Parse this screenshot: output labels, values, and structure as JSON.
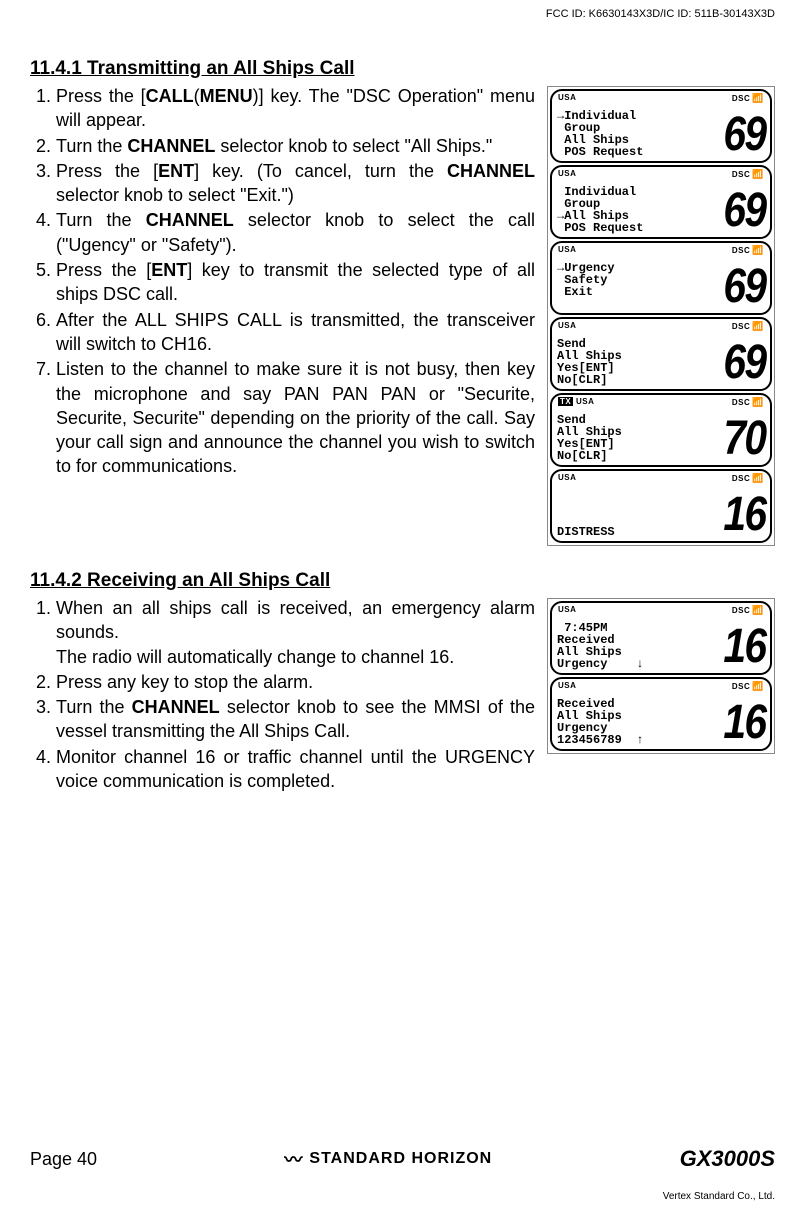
{
  "fcc": "FCC ID: K6630143X3D/IC ID: 511B-30143X3D",
  "section1": {
    "heading": "11.4.1  Transmitting an All Ships Call",
    "steps": {
      "s1a": "Press the [",
      "s1b": "CALL",
      "s1c": "(",
      "s1d": "MENU",
      "s1e": ")] key. The \"",
      "s1f": "DSC Operation",
      "s1g": "\" menu will appear.",
      "s2a": "Turn the ",
      "s2b": "CHANNEL",
      "s2c": " selector knob to select \"",
      "s2d": "All Ships",
      "s2e": ".\"",
      "s3a": "Press the [",
      "s3b": "ENT",
      "s3c": "] key. (To cancel, turn the ",
      "s3d": "CHANNEL",
      "s3e": " selector knob to select \"",
      "s3f": "Exit",
      "s3g": ".\")",
      "s4a": "Turn the ",
      "s4b": "CHANNEL",
      "s4c": " selector knob to select the call (\"",
      "s4d": "Ugency",
      "s4e": "\" or \"",
      "s4f": "Safety",
      "s4g": "\").",
      "s5a": "Press the [",
      "s5b": "ENT",
      "s5c": "] key to transmit the selected type of all ships DSC call.",
      "s6": "After the ALL SHIPS CALL is transmitted, the transceiver will switch to CH16.",
      "s7": "Listen to the channel to make sure it is not busy, then key the microphone and say PAN PAN PAN or \"Securite, Securite, Securite\" depending on the priority of the call. Say your call sign and announce the channel you wish to switch to for communications."
    }
  },
  "section2": {
    "heading": "11.4.2 Receiving an All Ships Call",
    "steps": {
      "s1a": "When an all ships call is received, an emergency alarm sounds.",
      "s1b": "The radio will automatically change to channel 16.",
      "s2": "Press any key to stop the alarm.",
      "s3a": "Turn the ",
      "s3b": "CHANNEL",
      "s3c": " selector knob to see the MMSI of the vessel transmitting the All Ships Call.",
      "s4": "Monitor channel 16 or traffic channel until the URGENCY voice communication is completed."
    }
  },
  "lcd": {
    "usa": "USA",
    "dsc": "DSC",
    "tx": "TX",
    "screens1": [
      {
        "lines": "→Individual\n Group\n All Ships\n POS Request",
        "num": "69",
        "tx": false
      },
      {
        "lines": " Individual\n Group\n→All Ships\n POS Request",
        "num": "69",
        "tx": false
      },
      {
        "lines": "→Urgency\n Safety\n Exit\n ",
        "num": "69",
        "tx": false
      },
      {
        "lines": "Send\nAll Ships\nYes[ENT]\nNo[CLR]",
        "num": "69",
        "tx": false
      },
      {
        "lines": "Send\nAll Ships\nYes[ENT]\nNo[CLR]",
        "num": "70",
        "tx": true
      },
      {
        "lines": "\n\n\nDISTRESS",
        "num": "16",
        "tx": false
      }
    ],
    "screens2": [
      {
        "lines": " 7:45PM\nReceived\nAll Ships\nUrgency    ↓",
        "num": "16",
        "tx": false
      },
      {
        "lines": "Received\nAll Ships\nUrgency\n123456789  ↑",
        "num": "16",
        "tx": false
      }
    ]
  },
  "footer": {
    "page": "Page 40",
    "brand": "STANDARD HORIZON",
    "model": "GX3000S",
    "vertex": "Vertex Standard Co., Ltd."
  }
}
